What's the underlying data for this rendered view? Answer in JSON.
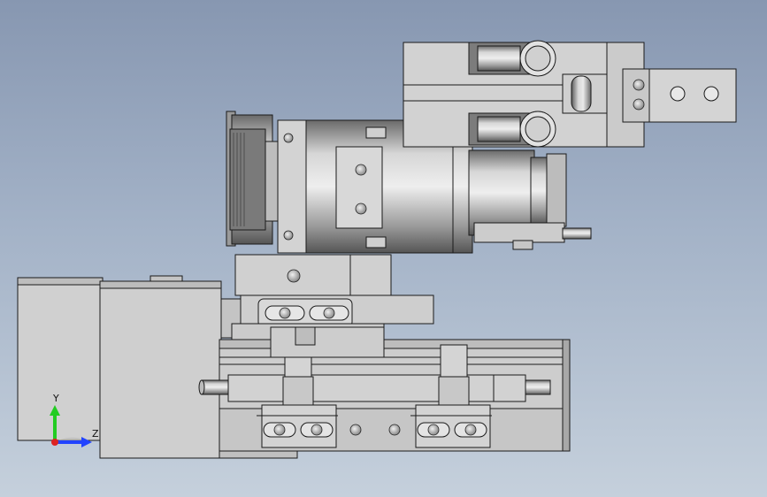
{
  "viewport": {
    "background_top": "#8797b1",
    "background_bottom": "#c5d0dc"
  },
  "model": {
    "body_color": "#c9c9c9",
    "edge_color": "#1a1a1a",
    "cylinder_light": "#e2e2e2",
    "cylinder_dark": "#5b5b5b"
  },
  "triad": {
    "y_label": "Y",
    "z_label": "Z",
    "y_color": "#22cc22",
    "z_color": "#2244ff",
    "origin_color": "#dd2222"
  }
}
